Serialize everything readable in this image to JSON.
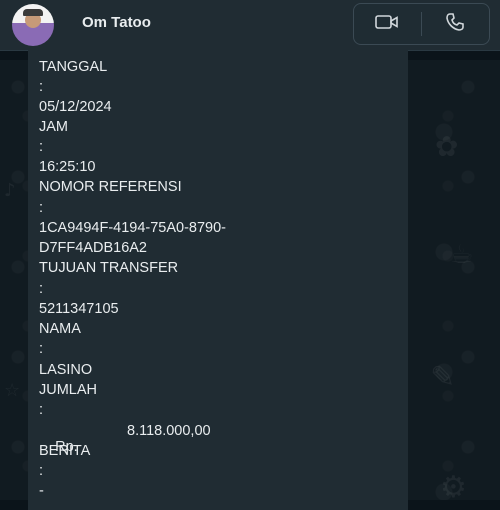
{
  "header": {
    "contact_name": "Om Tatoo",
    "video_call_icon": "video-camera-icon",
    "voice_call_icon": "phone-icon"
  },
  "message": {
    "tanggal_label": "TANGGAL",
    "tanggal_sep": ":",
    "tanggal_value": "05/12/2024",
    "jam_label": "JAM",
    "jam_sep": ":",
    "jam_value": "16:25:10",
    "referensi_label": "NOMOR REFERENSI",
    "referensi_sep": ":",
    "referensi_value_line1": "1CA9494F-4194-75A0-8790-",
    "referensi_value_line2": "D7FF4ADB16A2",
    "tujuan_label": "TUJUAN TRANSFER",
    "tujuan_sep": ":",
    "tujuan_value": "5211347105",
    "nama_label": "NAMA",
    "nama_sep": ":",
    "nama_value": "LASINO",
    "jumlah_label": "JUMLAH",
    "jumlah_sep": ":",
    "jumlah_currency": "Rp.",
    "jumlah_amount": "8.118.000,00",
    "berita_label": "BERITA",
    "berita_sep": ":",
    "berita_value": "-"
  },
  "colors": {
    "header_bg": "#202c33",
    "bubble_bg": "#202c33",
    "text": "#e9edef",
    "wallpaper": "#111b21"
  }
}
